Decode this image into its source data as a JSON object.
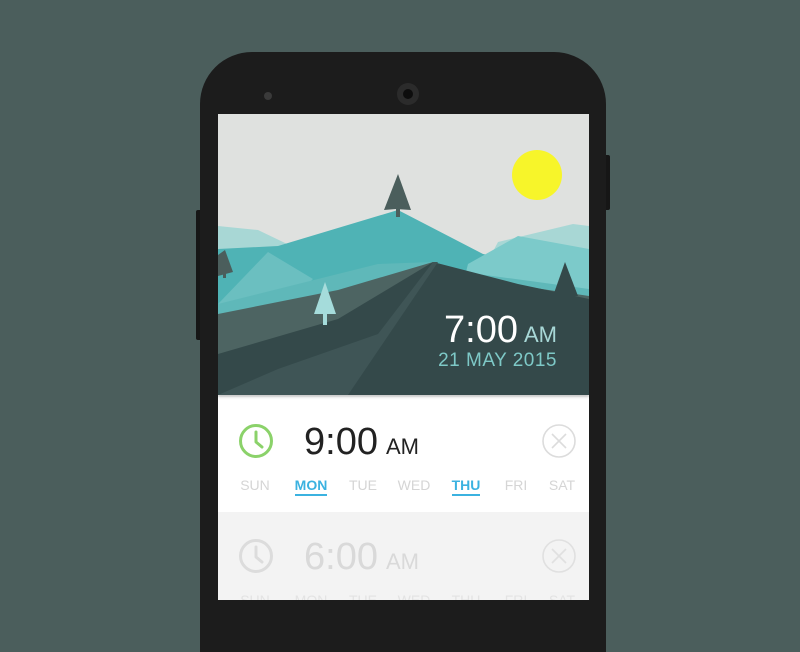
{
  "hero": {
    "time": "7:00",
    "ampm": "AM",
    "date": "21 MAY 2015"
  },
  "alarms": [
    {
      "time": "9:00",
      "ampm": "AM",
      "enabled": true,
      "days": [
        {
          "label": "SUN",
          "on": false
        },
        {
          "label": "MON",
          "on": true
        },
        {
          "label": "TUE",
          "on": false
        },
        {
          "label": "WED",
          "on": false
        },
        {
          "label": "THU",
          "on": true
        },
        {
          "label": "FRI",
          "on": false
        },
        {
          "label": "SAT",
          "on": false
        }
      ]
    },
    {
      "time": "6:00",
      "ampm": "AM",
      "enabled": false,
      "days": [
        {
          "label": "SUN",
          "on": false
        },
        {
          "label": "MON",
          "on": false
        },
        {
          "label": "TUE",
          "on": false
        },
        {
          "label": "WED",
          "on": false
        },
        {
          "label": "THU",
          "on": false
        },
        {
          "label": "FRI",
          "on": false
        },
        {
          "label": "SAT",
          "on": false
        }
      ]
    }
  ],
  "colors": {
    "background": "#4b5e5c",
    "sky": "#dfe1df",
    "sun": "#f7f52a",
    "accent_green": "#8bd26a",
    "accent_blue": "#3bb2e0",
    "mountain_dark": "#34494a",
    "mountain_teal": "#4fb3b5"
  },
  "icons": {
    "alarm_clock": "clock-icon",
    "delete": "close-circle-icon"
  }
}
